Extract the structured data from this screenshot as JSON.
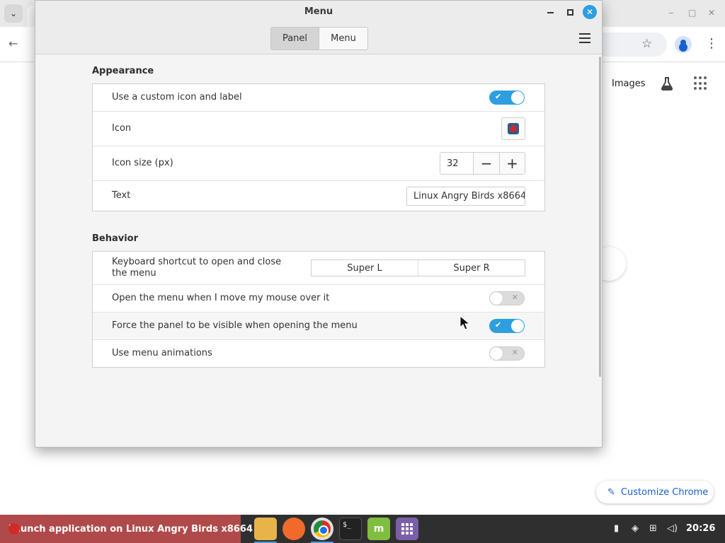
{
  "dialog": {
    "title": "Menu",
    "close_glyph": "✕",
    "tabs": [
      {
        "label": "Panel",
        "active": true
      },
      {
        "label": "Menu",
        "active": false
      }
    ],
    "appearance": {
      "title": "Appearance",
      "custom_icon_label": "Use a custom icon and label",
      "custom_icon_enabled": true,
      "icon_label": "Icon",
      "icon_size_label": "Icon size (px)",
      "icon_size_value": "32",
      "minus_glyph": "−",
      "plus_glyph": "+",
      "text_label": "Text",
      "text_value": "Linux Angry Birds x8664"
    },
    "behavior": {
      "title": "Behavior",
      "shortcut_label": "Keyboard shortcut to open and close the menu",
      "shortcut_primary": "Super L",
      "shortcut_secondary": "Super R",
      "hover_label": "Open the menu when I move my mouse over it",
      "hover_enabled": false,
      "force_visible_label": "Force the panel to be visible when opening the menu",
      "force_visible_enabled": true,
      "animations_label": "Use menu animations",
      "animations_enabled": false
    },
    "toggle_on_glyph": "✔",
    "toggle_off_glyph": "✕"
  },
  "chrome": {
    "images_link": "Images",
    "customize_label": "Customize Chrome",
    "pencil_glyph": "✎",
    "back_glyph": "←",
    "star_glyph": "☆",
    "kebab_glyph": "⋮",
    "tab_dropdown_glyph": "⌄"
  },
  "taskbar": {
    "active_app_label": "Launch application on Linux Angry Birds x8664",
    "terminal_glyph": "$_",
    "mint_glyph": "m",
    "clock": "20:26"
  },
  "colors": {
    "accent": "#2d9fe0",
    "active_task": "#b04a4a",
    "taskbar": "#2f2f2f"
  }
}
